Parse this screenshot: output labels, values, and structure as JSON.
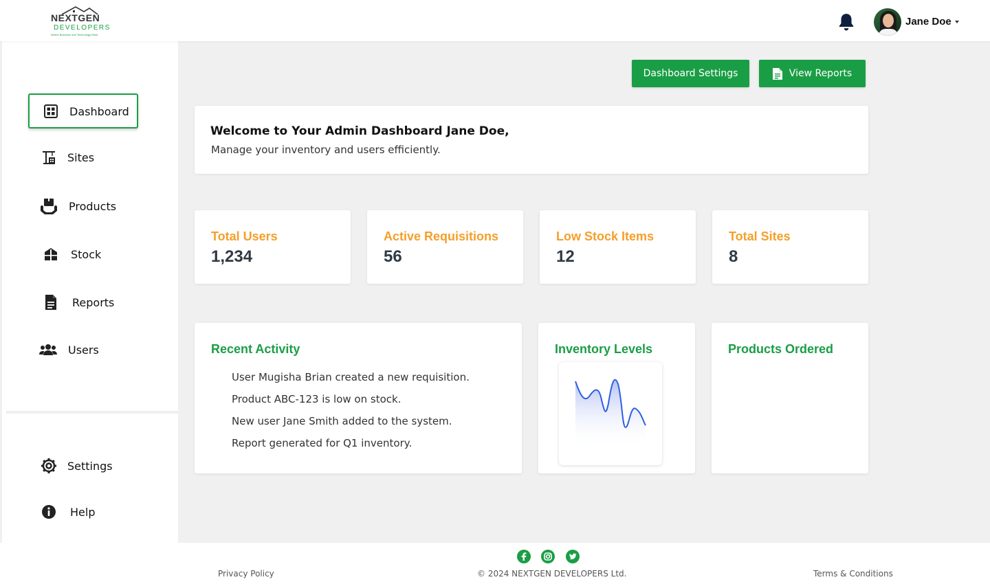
{
  "header": {
    "logo": {
      "top": "NEXTGEN",
      "bottom": "DEVELOPERS",
      "tagline": "Where Business and Technology Meet"
    },
    "user": {
      "name": "Jane Doe"
    },
    "icons": {
      "notification": "bell-icon",
      "dropdown": "caret-down-icon"
    }
  },
  "sidebar": {
    "items": [
      {
        "label": "Dashboard",
        "icon": "grid-icon",
        "active": true
      },
      {
        "label": "Sites",
        "icon": "construction-crane-icon"
      },
      {
        "label": "Products",
        "icon": "box-hand-icon"
      },
      {
        "label": "Stock",
        "icon": "warehouse-icon"
      },
      {
        "label": "Reports",
        "icon": "document-icon"
      },
      {
        "label": "Users",
        "icon": "users-icon"
      }
    ],
    "bottom_items": [
      {
        "label": "Settings",
        "icon": "gear-icon"
      },
      {
        "label": "Help",
        "icon": "info-icon"
      }
    ]
  },
  "toolbar": {
    "settings_label": "Dashboard Settings",
    "reports_label": "View Reports"
  },
  "welcome": {
    "title": "Welcome to Your Admin Dashboard Jane Doe,",
    "subtitle": "Manage your inventory and users efficiently."
  },
  "stats": [
    {
      "label": "Total Users",
      "value": "1,234"
    },
    {
      "label": "Active Requisitions",
      "value": "56"
    },
    {
      "label": "Low Stock Items",
      "value": "12"
    },
    {
      "label": "Total Sites",
      "value": "8"
    }
  ],
  "panels": {
    "activity": {
      "title": "Recent Activity",
      "items": [
        "User Mugisha Brian created a new requisition.",
        "Product ABC-123 is low on stock.",
        "New user Jane Smith added to the system.",
        "Report generated for Q1 inventory."
      ]
    },
    "inventory": {
      "title": "Inventory Levels"
    },
    "products": {
      "title": "Products Ordered"
    }
  },
  "footer": {
    "privacy": "Privacy Policy",
    "copyright": "© 2024 NEXTGEN DEVELOPERS Ltd.",
    "terms": "Terms & Conditions",
    "social": [
      "facebook-icon",
      "instagram-icon",
      "twitter-icon"
    ]
  },
  "colors": {
    "accent": "#1a9e45",
    "stat_label": "#f59f2a",
    "chart_line": "#2f5fe0"
  }
}
